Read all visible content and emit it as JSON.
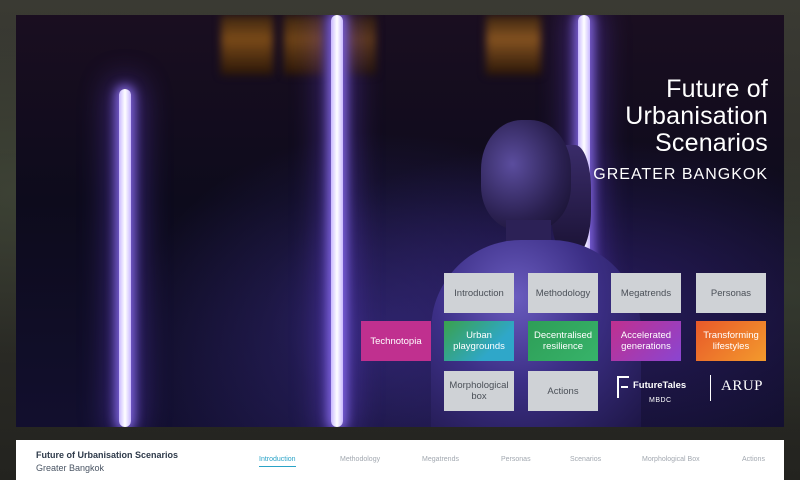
{
  "hero": {
    "title_lines": [
      "Future of",
      "Urbanisation",
      "Scenarios"
    ],
    "subtitle": "GREATER BANGKOK"
  },
  "tiles": {
    "introduction": "Introduction",
    "methodology": "Methodology",
    "megatrends": "Megatrends",
    "personas": "Personas",
    "technotopia": "Technotopia",
    "urban_playgrounds": "Urban playgrounds",
    "decentralised_resilience": "Decentralised resilience",
    "accelerated_generations": "Accelerated generations",
    "transforming_lifestyles": "Transforming lifestyles",
    "morphological_box": "Morphological box",
    "actions": "Actions"
  },
  "tile_colors": {
    "technotopia": "#c0308f",
    "urban_playgrounds": "#2fa7c9",
    "decentralised_resilience": "#2e9e57",
    "accelerated_generations": "#b13fc2",
    "transforming_lifestyles": "#f07a2a"
  },
  "logos": {
    "futuretales": "FutureTales",
    "futuretales_by": "MBDC",
    "arup": "ARUP"
  },
  "navbar": {
    "title": "Future of Urbanisation Scenarios",
    "subtitle": "Greater Bangkok",
    "links": [
      "Introduction",
      "Methodology",
      "Megatrends",
      "Personas",
      "Scenarios",
      "Morphological Box",
      "Actions"
    ]
  },
  "icons": [
    "futuretales-logo-icon",
    "arup-logo-icon"
  ]
}
